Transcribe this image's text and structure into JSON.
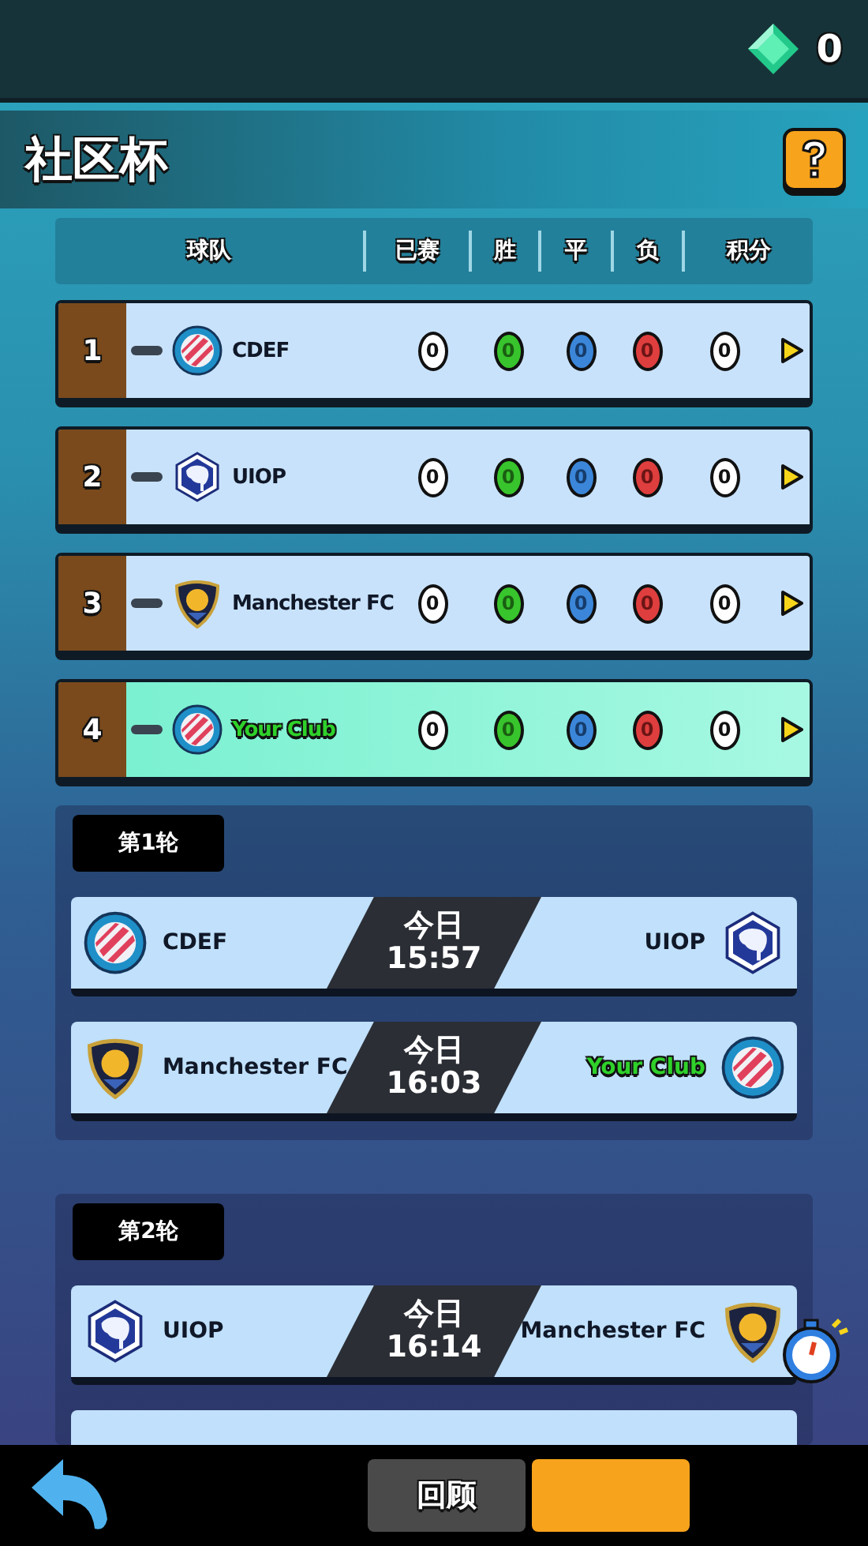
{
  "top_bar": {
    "gems": "0"
  },
  "title": "社区杯",
  "standings": {
    "columns": [
      "球队",
      "已赛",
      "胜",
      "平",
      "负",
      "积分"
    ],
    "rows": [
      {
        "rank": "1",
        "crest": {
          "kind": "stripes"
        },
        "team": "CDEF",
        "own_team": false,
        "played": "0",
        "won": "0",
        "drawn": "0",
        "lost": "0",
        "points": "0"
      },
      {
        "rank": "2",
        "crest": {
          "kind": "elephant"
        },
        "team": "UIOP",
        "own_team": false,
        "played": "0",
        "won": "0",
        "drawn": "0",
        "lost": "0",
        "points": "0"
      },
      {
        "rank": "3",
        "crest": {
          "kind": "shield"
        },
        "team": "Manchester FC",
        "own_team": false,
        "played": "0",
        "won": "0",
        "drawn": "0",
        "lost": "0",
        "points": "0"
      },
      {
        "rank": "4",
        "crest": {
          "kind": "stripes"
        },
        "team": "Your Club",
        "own_team": true,
        "played": "0",
        "won": "0",
        "drawn": "0",
        "lost": "0",
        "points": "0"
      }
    ]
  },
  "rounds": [
    {
      "label": "第1轮",
      "matches": [
        {
          "kind": "full",
          "home": {
            "team": "CDEF",
            "crest": {
              "kind": "stripes"
            },
            "own_team": false
          },
          "away": {
            "team": "UIOP",
            "crest": {
              "kind": "elephant"
            },
            "own_team": false
          },
          "day": "今日",
          "time": "15:57"
        },
        {
          "kind": "full",
          "home": {
            "team": "Manchester FC",
            "crest": {
              "kind": "shield"
            },
            "own_team": false
          },
          "away": {
            "team": "Your Club",
            "crest": {
              "kind": "stripes"
            },
            "own_team": true
          },
          "day": "今日",
          "time": "16:03"
        }
      ]
    },
    {
      "label": "第2轮",
      "matches": [
        {
          "kind": "full",
          "home": {
            "team": "UIOP",
            "crest": {
              "kind": "elephant"
            },
            "own_team": false
          },
          "away": {
            "team": "Manchester FC",
            "crest": {
              "kind": "shield"
            },
            "own_team": false
          },
          "day": "今日",
          "time": "16:14"
        },
        {
          "kind": "cut"
        }
      ]
    }
  ],
  "bottom_bar": {
    "buttons": [
      {
        "kind": "review",
        "label": "回顾"
      },
      {
        "kind": "action"
      }
    ]
  }
}
